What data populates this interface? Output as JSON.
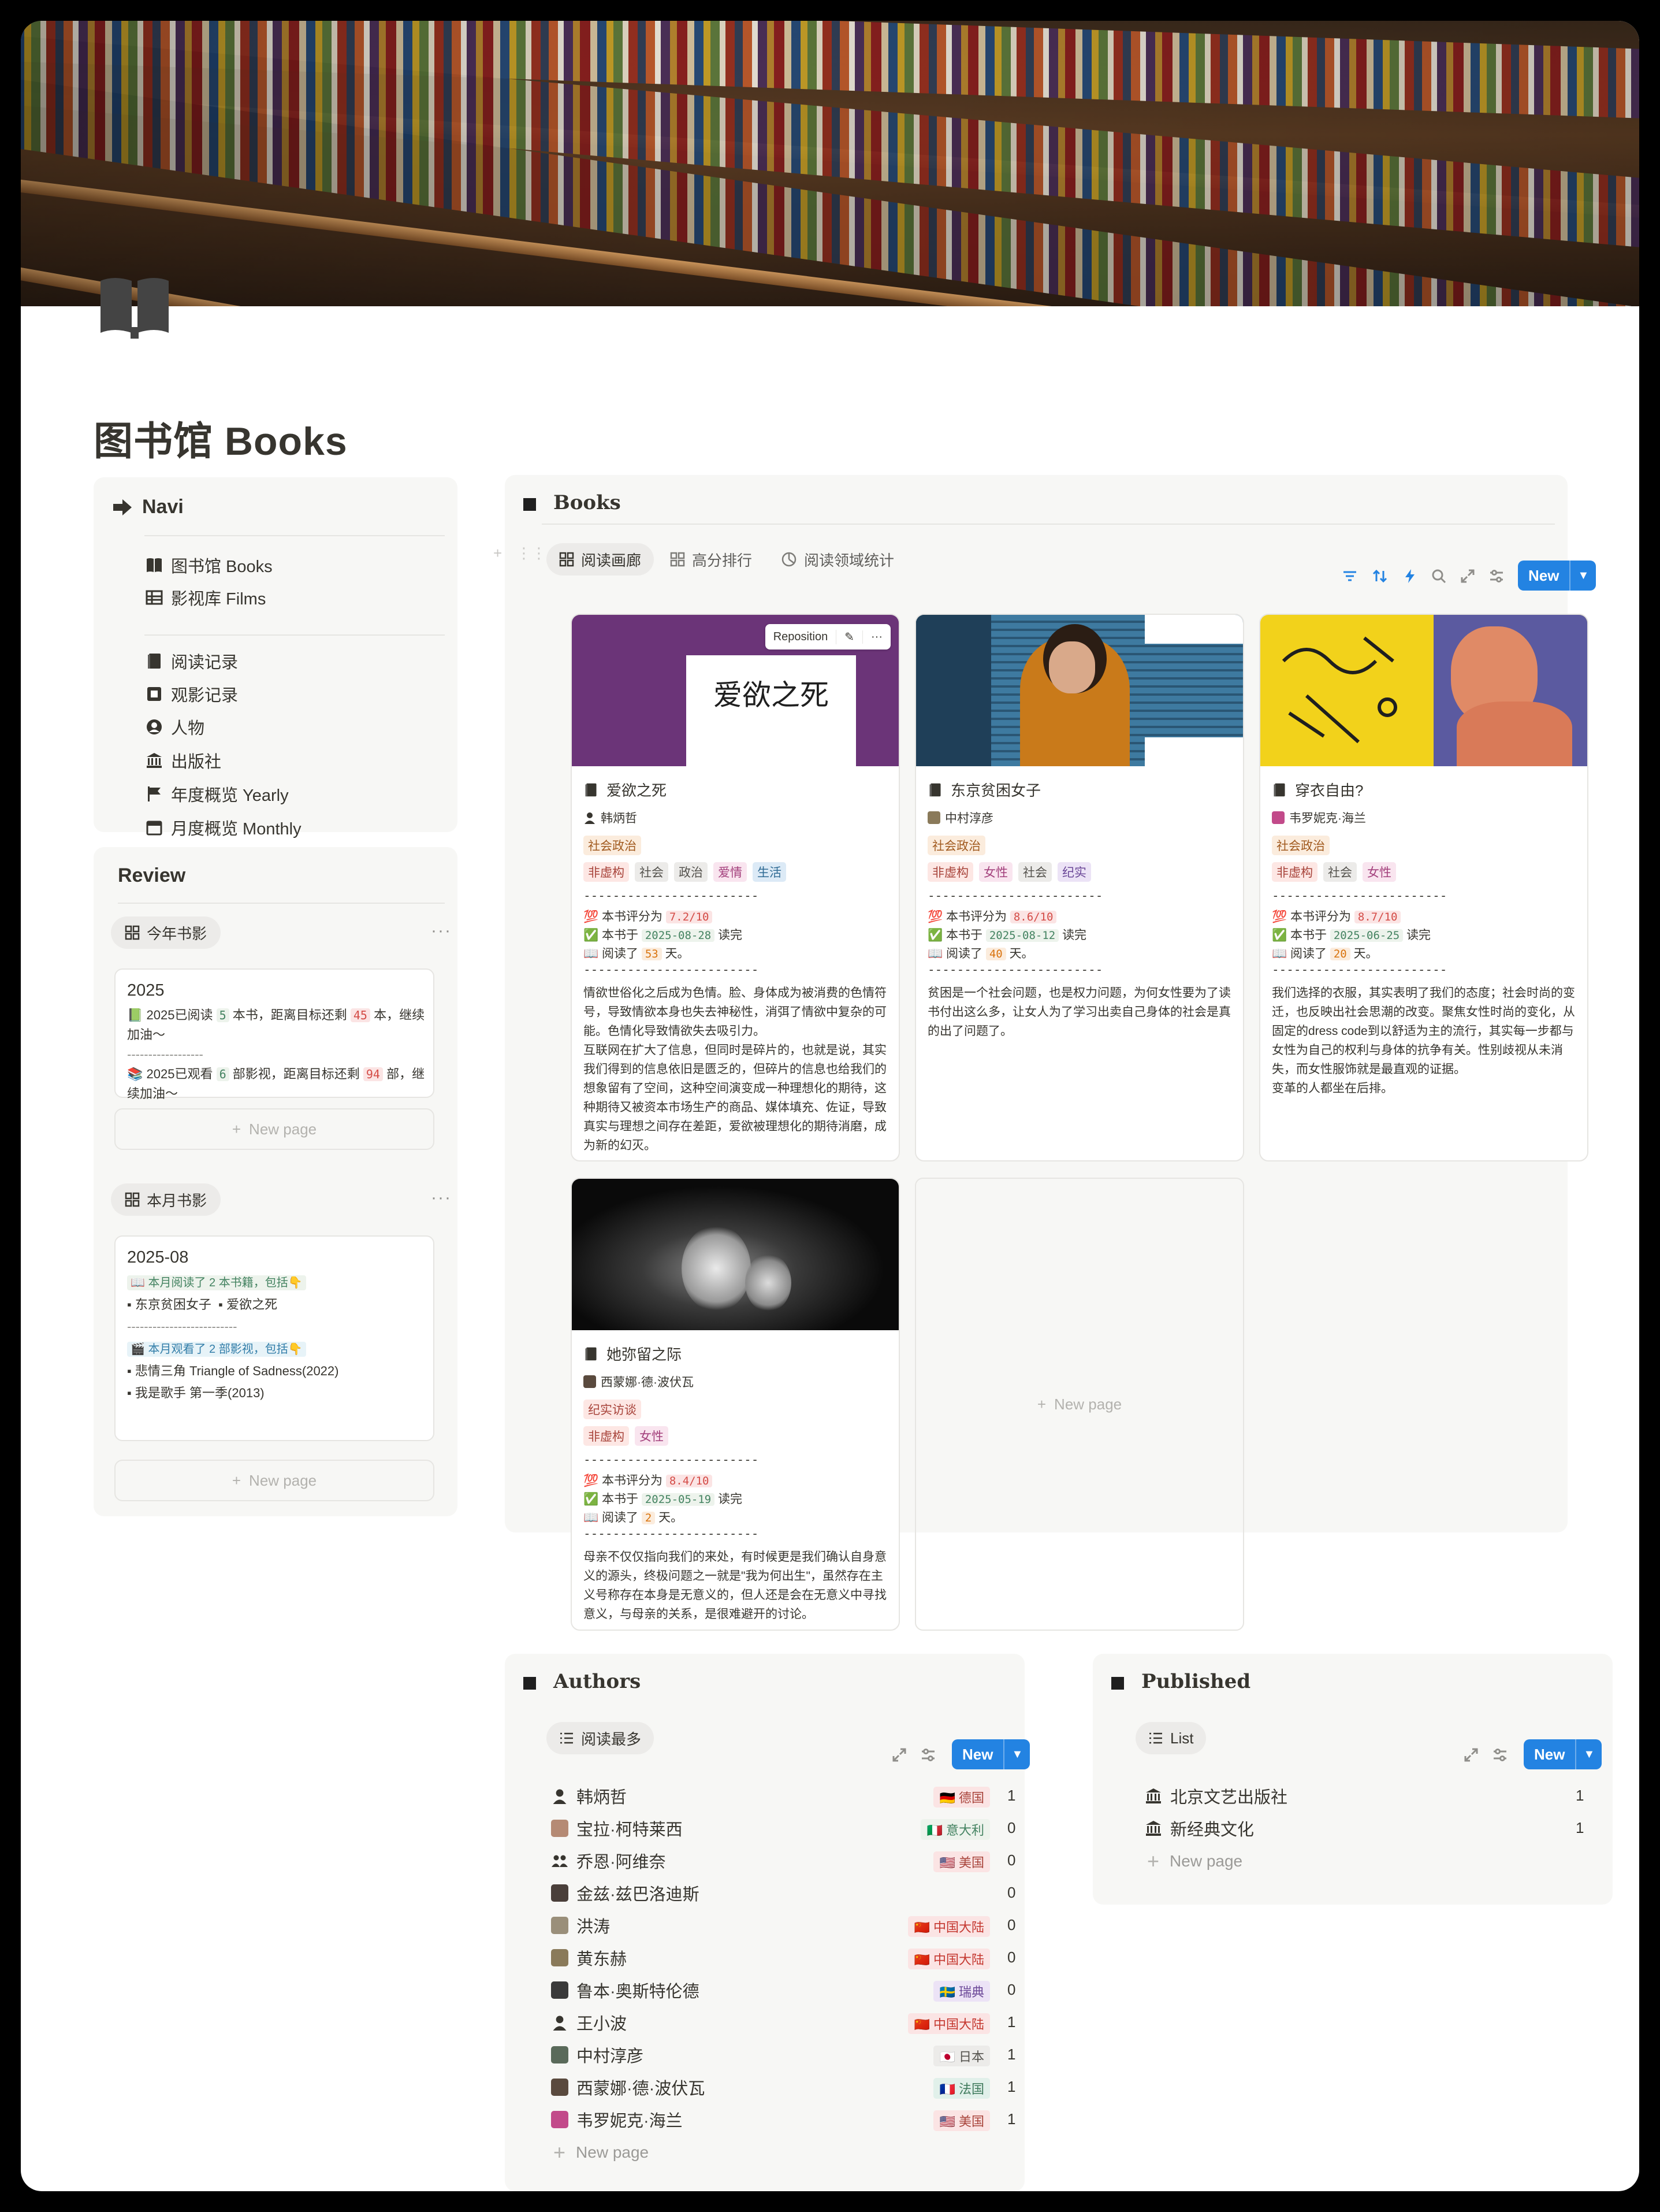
{
  "page": {
    "title": "图书馆 Books",
    "icon": "open-book-icon"
  },
  "navi": {
    "title": "Navi",
    "icon": "arrow-right-icon",
    "group1": [
      {
        "label": "图书馆 Books",
        "icon": "book-icon"
      },
      {
        "label": "影视库 Films",
        "icon": "table-icon"
      }
    ],
    "group2": [
      {
        "label": "阅读记录",
        "icon": "book-icon"
      },
      {
        "label": "观影记录",
        "icon": "film-icon"
      },
      {
        "label": "人物",
        "icon": "person-icon"
      },
      {
        "label": "出版社",
        "icon": "building-icon"
      },
      {
        "label": "年度概览 Yearly",
        "icon": "flag-icon"
      },
      {
        "label": "月度概览 Monthly",
        "icon": "calendar-icon"
      }
    ]
  },
  "review": {
    "title": "Review",
    "yearly_view": "今年书影",
    "yearly_card": {
      "title": "2025",
      "line1_a": "📗 2025已阅读",
      "line1_n": "5",
      "line1_b": "本书，距离目标还剩",
      "line1_m": "45",
      "line1_c": "本，继续加油～",
      "divider": "------------------",
      "line2_a": "📚 2025已观看",
      "line2_n": "6",
      "line2_b": "部影视，距离目标还剩",
      "line2_m": "94",
      "line2_c": "部，继续加油～"
    },
    "new_page": "New page",
    "monthly_view": "本月书影",
    "monthly_card": {
      "title": "2025-08",
      "read_hl": "📖 本月阅读了 2 本书籍，包括👇",
      "books": [
        "东京贫困女子",
        "爱欲之死"
      ],
      "divider": "--------------------------",
      "watch_hl": "🎬 本月观看了 2 部影视，包括👇",
      "films": [
        "悲情三角 Triangle of Sadness(2022)",
        "我是歌手 第一季(2013)"
      ]
    }
  },
  "books_db": {
    "title": "Books",
    "tabs": [
      {
        "label": "阅读画廊",
        "icon": "gallery-icon"
      },
      {
        "label": "高分排行",
        "icon": "gallery-icon"
      },
      {
        "label": "阅读领域统计",
        "icon": "pie-chart-icon"
      }
    ],
    "new_label": "New",
    "reposition_label": "Reposition",
    "new_page": "New page",
    "cards": [
      {
        "name": "爱欲之死",
        "author": "韩炳哲",
        "category": "社会政治",
        "tags": [
          "非虚构",
          "社会",
          "政治",
          "爱情",
          "生活"
        ],
        "divider": "------------------------",
        "score_pre": "💯 本书评分为",
        "score": "7.2/10",
        "date_pre": "✅ 本书于",
        "date": "2025-08-28",
        "date_post": "读完",
        "days_pre": "📖 阅读了",
        "days": "53",
        "days_post": "天。",
        "desc": "情欲世俗化之后成为色情。脸、身体成为被消费的色情符号，导致情欲本身也失去神秘性，消弭了情欲中复杂的可能。色情化导致情欲失去吸引力。\n互联网在扩大了信息，但同时是碎片的，也就是说，其实我们得到的信息依旧是匮乏的，但碎片的信息也给我们的想象留有了空间，这种空间演变成一种理想化的期待，这种期待又被资本市场生产的商品、媒体填充、佐证，导致真实与理想之间存在差距，爱欲被理想化的期待消磨，成为新的幻灭。",
        "cover_title": "爱欲之死"
      },
      {
        "name": "东京贫困女子",
        "author": "中村淳彦",
        "category": "社会政治",
        "tags": [
          "非虚构",
          "女性",
          "社会",
          "纪实"
        ],
        "divider": "------------------------",
        "score_pre": "💯 本书评分为",
        "score": "8.6/10",
        "date_pre": "✅ 本书于",
        "date": "2025-08-12",
        "date_post": "读完",
        "days_pre": "📖 阅读了",
        "days": "40",
        "days_post": "天。",
        "desc": "贫困是一个社会问题，也是权力问题，为何女性要为了读书付出这么多，让女人为了学习出卖自己身体的社会是真的出了问题了。"
      },
      {
        "name": "穿衣自由?",
        "author": "韦罗妮克·海兰",
        "category": "社会政治",
        "tags": [
          "非虚构",
          "社会",
          "女性"
        ],
        "divider": "------------------------",
        "score_pre": "💯 本书评分为",
        "score": "8.7/10",
        "date_pre": "✅ 本书于",
        "date": "2025-06-25",
        "date_post": "读完",
        "days_pre": "📖 阅读了",
        "days": "20",
        "days_post": "天。",
        "desc": "我们选择的衣服，其实表明了我们的态度；社会时尚的变迁，也反映出社会思潮的改变。聚焦女性时尚的变化，从固定的dress code到以舒适为主的流行，其实每一步都与女性为自己的权利与身体的抗争有关。性别歧视从未消失，而女性服饰就是最直观的证据。\n变革的人都坐在后排。"
      },
      {
        "name": "她弥留之际",
        "author": "西蒙娜·德·波伏瓦",
        "category": "纪实访谈",
        "tags": [
          "非虚构",
          "女性"
        ],
        "divider": "------------------------",
        "score_pre": "💯 本书评分为",
        "score": "8.4/10",
        "date_pre": "✅ 本书于",
        "date": "2025-05-19",
        "date_post": "读完",
        "days_pre": "📖 阅读了",
        "days": "2",
        "days_post": "天。",
        "desc": "母亲不仅仅指向我们的来处，有时候更是我们确认自身意义的源头，终极问题之一就是\"我为何出生\"，虽然存在主义号称存在本身是无意义的，但人还是会在无意义中寻找意义，与母亲的关系，是很难避开的讨论。"
      }
    ]
  },
  "authors_db": {
    "title": "Authors",
    "view": "阅读最多",
    "new_label": "New",
    "new_page": "New page",
    "rows": [
      {
        "name": "韩炳哲",
        "country": "🇩🇪 德国",
        "count": "1",
        "avatar": "person-icon"
      },
      {
        "name": "宝拉·柯特莱西",
        "country": "🇮🇹 意大利",
        "count": "0",
        "avatar": "photo"
      },
      {
        "name": "乔恩·阿维奈",
        "country": "🇺🇸 美国",
        "count": "0",
        "avatar": "people-icon"
      },
      {
        "name": "金兹·兹巴洛迪斯",
        "country": "",
        "count": "0",
        "avatar": "photo"
      },
      {
        "name": "洪涛",
        "country": "🇨🇳 中国大陆",
        "count": "0",
        "avatar": "photo"
      },
      {
        "name": "黄东赫",
        "country": "🇨🇳 中国大陆",
        "count": "0",
        "avatar": "photo"
      },
      {
        "name": "鲁本·奥斯特伦德",
        "country": "🇸🇪 瑞典",
        "count": "0",
        "avatar": "photo"
      },
      {
        "name": "王小波",
        "country": "🇨🇳 中国大陆",
        "count": "1",
        "avatar": "person-icon"
      },
      {
        "name": "中村淳彦",
        "country": "🇯🇵 日本",
        "count": "1",
        "avatar": "photo"
      },
      {
        "name": "西蒙娜·德·波伏瓦",
        "country": "🇫🇷 法国",
        "count": "1",
        "avatar": "photo"
      },
      {
        "name": "韦罗妮克·海兰",
        "country": "🇺🇸 美国",
        "count": "1",
        "avatar": "photo"
      }
    ]
  },
  "published_db": {
    "title": "Published",
    "view": "List",
    "new_label": "New",
    "new_page": "New page",
    "rows": [
      {
        "name": "北京文艺出版社",
        "count": "1"
      },
      {
        "name": "新经典文化",
        "count": "1"
      }
    ]
  },
  "colors": {
    "accent": "#2383e2",
    "panel": "#f7f7f5",
    "text": "#37352f"
  }
}
